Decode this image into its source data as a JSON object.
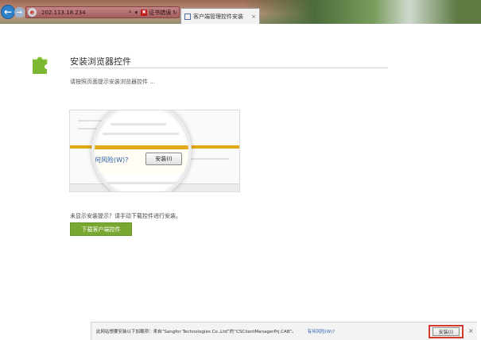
{
  "browser": {
    "address_url": "202.113.18.234",
    "address_cert_label": "证书错误",
    "tab_title": "客户端管理控件安装",
    "tab_close": "×"
  },
  "main": {
    "title": "安装浏览器控件",
    "subtitle": "请按照页面提示安装浏览器控件 ...",
    "illustration": {
      "risk_text": "何风险(W)?",
      "install_label": "安装(I)"
    },
    "hint": "未显示安装提示？请手动下载控件进行安装。",
    "download_button": "下载客户端控件"
  },
  "notification": {
    "message": "此网站想要安装以下加载项：来自“Sangfor Technologies Co.,Ltd”的“CSClientManagerPrj.CAB”。",
    "risk_link": "有何风险(W)?",
    "install_button": "安装(I)",
    "close": "×"
  },
  "colors": {
    "accent_green": "#79a832",
    "highlight_red": "#d43a2a",
    "bar_orange": "#e3a818"
  }
}
